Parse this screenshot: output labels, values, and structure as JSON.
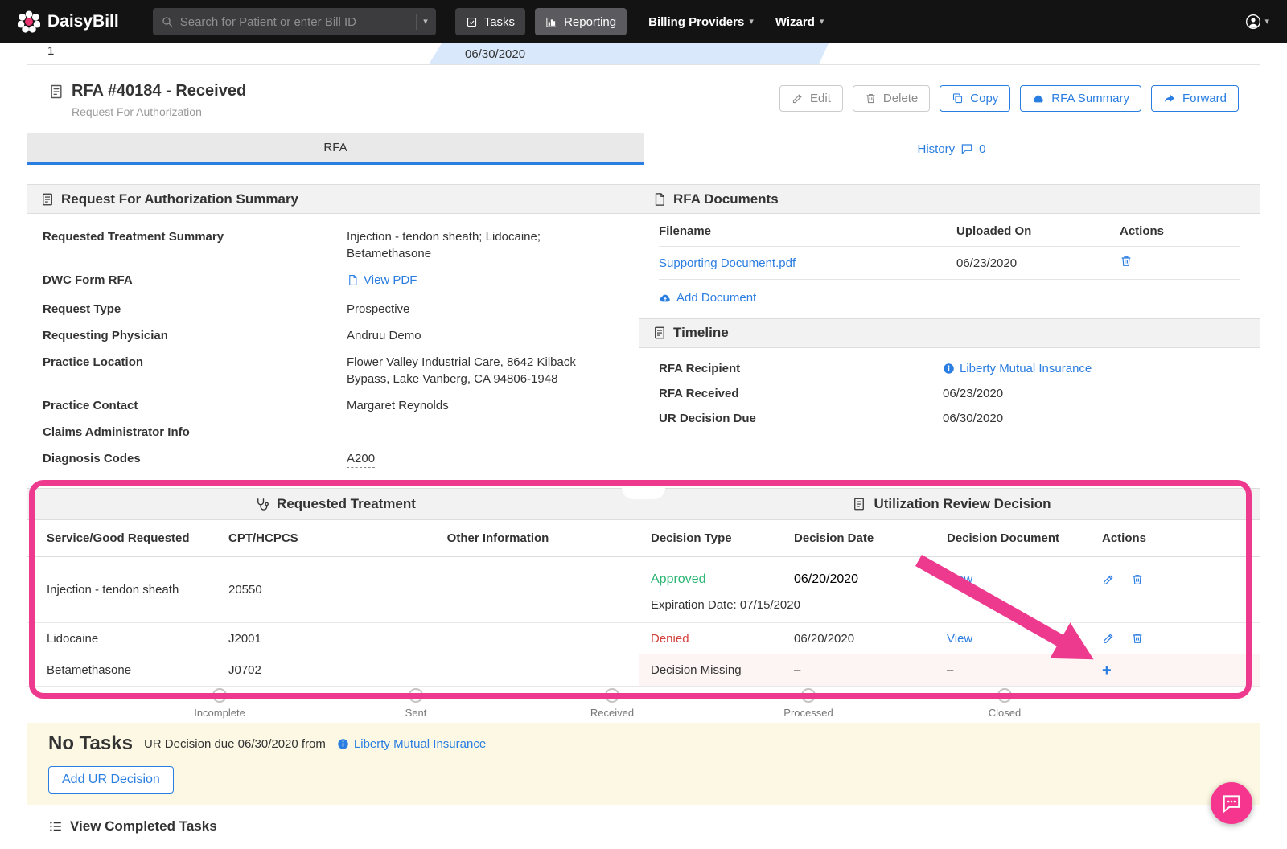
{
  "colors": {
    "accent_blue": "#2a7de1",
    "approved_green": "#2bb673",
    "denied_red": "#d43f3a",
    "annotation_pink": "#ee3a8e",
    "navbar_black": "#131313",
    "tasks_area_bg": "#fcf8e3"
  },
  "navbar": {
    "brand": "DaisyBill",
    "search_placeholder": "Search for Patient or enter Bill ID",
    "tasks": "Tasks",
    "reporting": "Reporting",
    "billing_providers": "Billing Providers",
    "wizard": "Wizard"
  },
  "remnant": {
    "row_number": "1",
    "due_date": "06/30/2020"
  },
  "header": {
    "title": "RFA #40184 - Received",
    "subtitle": "Request For Authorization",
    "edit": "Edit",
    "delete": "Delete",
    "copy": "Copy",
    "rfa_summary": "RFA Summary",
    "forward": "Forward"
  },
  "tabs": {
    "rfa": "RFA",
    "history": "History",
    "history_count": "0"
  },
  "summary": {
    "title": "Request For Authorization Summary",
    "fields": [
      {
        "label": "Requested Treatment Summary",
        "value": "Injection - tendon sheath; Lidocaine; Betamethasone"
      },
      {
        "label": "DWC Form RFA",
        "value": "View PDF"
      },
      {
        "label": "Request Type",
        "value": "Prospective"
      },
      {
        "label": "Requesting Physician",
        "value": "Andruu Demo"
      },
      {
        "label": "Practice Location",
        "value": "Flower Valley Industrial Care, 8642 Kilback Bypass, Lake Vanberg, CA 94806-1948"
      },
      {
        "label": "Practice Contact",
        "value": "Margaret Reynolds"
      },
      {
        "label": "Claims Administrator Info",
        "value": ""
      },
      {
        "label": "Diagnosis Codes",
        "value": "A200"
      }
    ]
  },
  "documents": {
    "title": "RFA Documents",
    "headers": [
      "Filename",
      "Uploaded On",
      "Actions"
    ],
    "rows": [
      {
        "filename": "Supporting Document.pdf",
        "uploaded_on": "06/23/2020"
      }
    ],
    "add_label": "Add Document"
  },
  "timeline": {
    "title": "Timeline",
    "rows": [
      {
        "label": "RFA Recipient",
        "value": "Liberty Mutual Insurance"
      },
      {
        "label": "RFA Received",
        "value": "06/23/2020"
      },
      {
        "label": "UR Decision Due",
        "value": "06/30/2020"
      }
    ]
  },
  "treatment": {
    "title": "Requested Treatment",
    "headers": [
      "Service/Good Requested",
      "CPT/HCPCS",
      "Other Information"
    ],
    "rows": [
      {
        "service": "Injection - tendon sheath",
        "code": "20550",
        "other": ""
      },
      {
        "service": "Lidocaine",
        "code": "J2001",
        "other": ""
      },
      {
        "service": "Betamethasone",
        "code": "J0702",
        "other": ""
      }
    ]
  },
  "ur": {
    "title": "Utilization Review Decision",
    "headers": [
      "Decision Type",
      "Decision Date",
      "Decision Document",
      "Actions"
    ],
    "rows": [
      {
        "type": "Approved",
        "date": "06/20/2020",
        "document": "View",
        "note": "Expiration Date: 07/15/2020"
      },
      {
        "type": "Denied",
        "date": "06/20/2020",
        "document": "View",
        "note": ""
      },
      {
        "type": "Decision Missing",
        "date": "–",
        "document": "–",
        "note": ""
      }
    ],
    "add_symbol": "+"
  },
  "progress": {
    "steps": [
      "Incomplete",
      "Sent",
      "Received",
      "Processed",
      "Closed"
    ]
  },
  "tasks": {
    "heading": "No Tasks",
    "description": "UR Decision due 06/30/2020 from",
    "insurer": "Liberty Mutual Insurance",
    "add_button": "Add UR Decision",
    "view_completed": "View Completed Tasks"
  }
}
